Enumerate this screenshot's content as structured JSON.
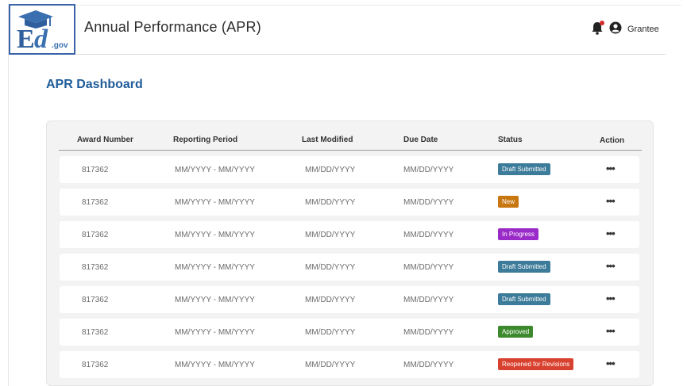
{
  "app": {
    "logo_text": "Ed.gov",
    "title": "Annual Performance (APR)",
    "user_name": "Grantee"
  },
  "dashboard": {
    "title": "APR Dashboard"
  },
  "table": {
    "headers": {
      "award_number": "Award Number",
      "reporting_period": "Reporting Period",
      "last_modified": "Last Modified",
      "due_date": "Due Date",
      "status": "Status",
      "action": "Action"
    },
    "rows": [
      {
        "award": "817362",
        "period": "MM/YYYY - MM/YYYY",
        "modified": "MM/DD/YYYY",
        "due": "MM/DD/YYYY",
        "status": "Draft Submitted",
        "status_color": "#3c7b99",
        "action": "•••"
      },
      {
        "award": "817362",
        "period": "MM/YYYY - MM/YYYY",
        "modified": "MM/DD/YYYY",
        "due": "MM/DD/YYYY",
        "status": "New",
        "status_color": "#c8760f",
        "action": "•••"
      },
      {
        "award": "817362",
        "period": "MM/YYYY - MM/YYYY",
        "modified": "MM/DD/YYYY",
        "due": "MM/DD/YYYY",
        "status": "In Progress",
        "status_color": "#9b2bc8",
        "action": "•••"
      },
      {
        "award": "817362",
        "period": "MM/YYYY - MM/YYYY",
        "modified": "MM/DD/YYYY",
        "due": "MM/DD/YYYY",
        "status": "Draft Submitted",
        "status_color": "#3c7b99",
        "action": "•••"
      },
      {
        "award": "817362",
        "period": "MM/YYYY - MM/YYYY",
        "modified": "MM/DD/YYYY",
        "due": "MM/DD/YYYY",
        "status": "Draft Submitted",
        "status_color": "#3c7b99",
        "action": "•••"
      },
      {
        "award": "817362",
        "period": "MM/YYYY - MM/YYYY",
        "modified": "MM/DD/YYYY",
        "due": "MM/DD/YYYY",
        "status": "Approved",
        "status_color": "#3d8a2e",
        "action": "•••"
      },
      {
        "award": "817362",
        "period": "MM/YYYY - MM/YYYY",
        "modified": "MM/DD/YYYY",
        "due": "MM/DD/YYYY",
        "status": "Reopened for Revisions",
        "status_color": "#d9412f",
        "action": "•••"
      }
    ]
  },
  "icons": {
    "logo": "ed-gov-logo",
    "notifications": "bell-icon",
    "user": "user-circle-icon",
    "row_menu": "more-horizontal-icon"
  },
  "colors": {
    "brand_blue": "#1f5c99",
    "notification_dot": "#d62c2c"
  }
}
